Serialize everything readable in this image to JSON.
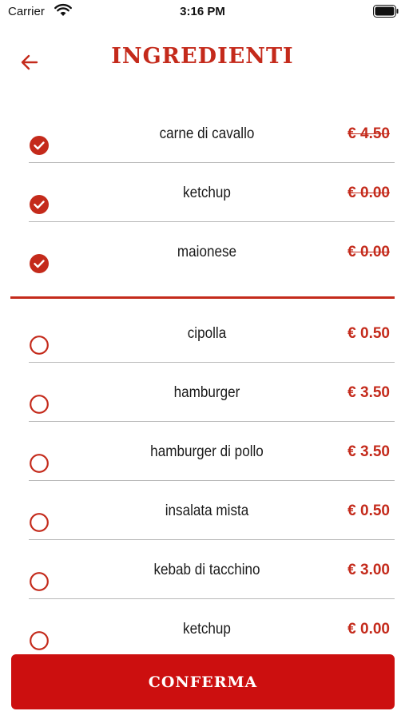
{
  "status": {
    "carrier": "Carrier",
    "time": "3:16 PM"
  },
  "header": {
    "title": "INGREDIENTI"
  },
  "selected_items": [
    {
      "name": "carne di cavallo",
      "price": "€ 4.50"
    },
    {
      "name": "ketchup",
      "price": "€ 0.00"
    },
    {
      "name": "maionese",
      "price": "€ 0.00"
    }
  ],
  "available_items": [
    {
      "name": "cipolla",
      "price": "€ 0.50"
    },
    {
      "name": "hamburger",
      "price": "€ 3.50"
    },
    {
      "name": "hamburger di pollo",
      "price": "€ 3.50"
    },
    {
      "name": "insalata mista",
      "price": "€ 0.50"
    },
    {
      "name": "kebab di tacchino",
      "price": "€ 3.00"
    },
    {
      "name": "ketchup",
      "price": "€ 0.00"
    }
  ],
  "footer": {
    "confirm_label": "CONFERMA"
  },
  "colors": {
    "accent": "#c42a1b",
    "button": "#cc0f0f",
    "divider": "#b8b8b8"
  }
}
